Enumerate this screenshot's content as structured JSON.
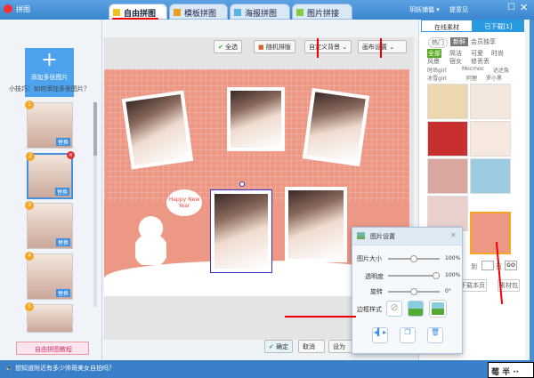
{
  "app": {
    "title": "拼图"
  },
  "tabs": [
    {
      "label": "自由拼图"
    },
    {
      "label": "模板拼图"
    },
    {
      "label": "海报拼图"
    },
    {
      "label": "图片拼接"
    }
  ],
  "header": {
    "user": "玥妖铺儡 ▾",
    "feedback": "提意见"
  },
  "left": {
    "add_label": "添加多张图片",
    "tip": "小技巧：如何添加多张图片？",
    "replace": "替换",
    "numbers": [
      "1",
      "2",
      "3",
      "4",
      "5"
    ],
    "tutorial": "自由拼图教程"
  },
  "toolbar": {
    "select_all": "全选",
    "random": "随机排版",
    "custom_bg": "自定义背景",
    "canvas_settings": "画布设置"
  },
  "canvas": {
    "bg_color": "#ec9885",
    "sticker_text": "Happy New Year"
  },
  "bottom": {
    "confirm": "确定",
    "cancel": "取消",
    "set_as": "设为"
  },
  "right": {
    "tab_online": "在线素材",
    "tab_downloaded": "已下载[1]",
    "subtabs": [
      "热门",
      "新鲜",
      "会员独享"
    ],
    "categories": [
      "全部",
      "简洁",
      "可爱",
      "时尚",
      "风景",
      "宿女",
      "修丢丢",
      "时尚girl",
      "Mocmoc",
      "达达兔",
      "冰雪girl",
      "阿狸",
      "罗小黑"
    ],
    "page_to": "到",
    "page_unit": "页",
    "go": "GO",
    "download_page": "下载本页",
    "pack": "素材包"
  },
  "dialog": {
    "title": "图片设置",
    "size_label": "图片大小",
    "size_value": "100%",
    "size": 0.5,
    "opacity_label": "透明度",
    "opacity_value": "100%",
    "opacity": 1.0,
    "rotate_label": "旋转",
    "rotate_value": "0°",
    "rotate": 0.5,
    "border_label": "边框样式"
  },
  "status": {
    "text": "想知道附近有多少帅哥美女自拍吗？"
  },
  "watermark": "莓 半 ··"
}
